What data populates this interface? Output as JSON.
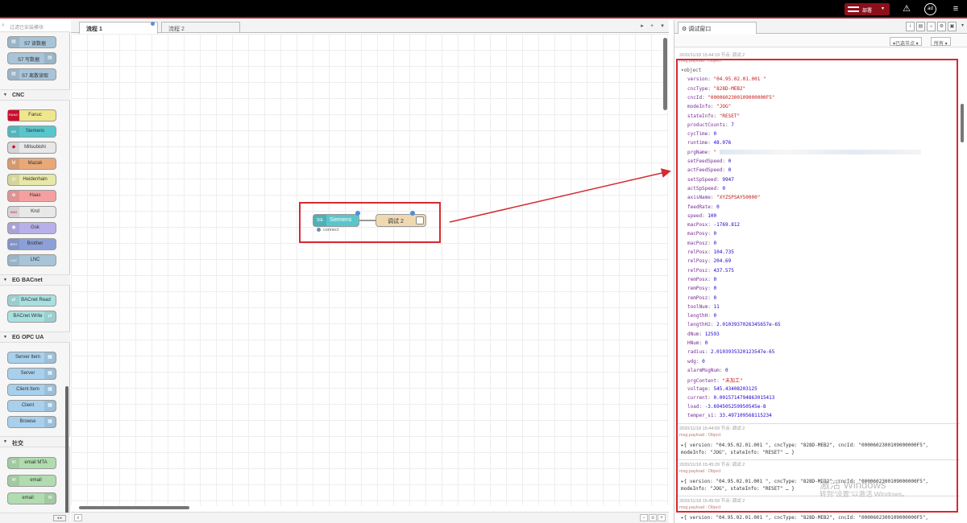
{
  "topbar": {
    "deploy_label": "部署",
    "deploy_caret": "▾",
    "alert_icon": "⚠",
    "user_label": "ad",
    "menu_icon": "≡"
  },
  "palette": {
    "search_placeholder": "过滤已安装模块",
    "top_nodes": [
      "S7 读数据",
      "S7 写数据",
      "S7 离散读取"
    ],
    "categories": {
      "cnc": "CNC",
      "bacnet": "EG BACnet",
      "opcua": "EG OPC UA",
      "social": "社交"
    },
    "cnc_nodes": [
      "Fanuc",
      "Siemens",
      "Mitsubishi",
      "Mazak",
      "Heidenhain",
      "Haas",
      "Knd",
      "Gsk",
      "Brother",
      "LNC"
    ],
    "cnc_icons": [
      "FANUC",
      "SIE",
      "◆",
      "M",
      "◎",
      "⊕",
      "KND",
      "◉",
      "BRO",
      "LNC"
    ],
    "bacnet_nodes": [
      "BACnet Read",
      "BACnet Write"
    ],
    "opcua_nodes": [
      "Server Item",
      "Server",
      "Client Item",
      "Client",
      "Browse"
    ],
    "social_nodes": [
      "email MTA",
      "email",
      "email"
    ]
  },
  "workspace": {
    "tabs": [
      "流程 1",
      "流程 2"
    ],
    "nodes": {
      "siemens_label": "Siemens",
      "siemens_icon": "SIE",
      "debug_label": "调试 2",
      "status_text": "connect"
    }
  },
  "sidebar": {
    "tab_label": "调试窗口",
    "filter_nodes": "▾已选节点 ▾",
    "filter_all": "所有 ▾",
    "first_msg": {
      "meta": "2020/11/18 15:44:19   节点: 调试 2",
      "topic": "msg.payload : Object",
      "object_label": "▾object",
      "props": [
        [
          "version",
          "\"04.95.02.01.001     \"",
          "s"
        ],
        [
          "cncType",
          "\"828D-MEB2\"",
          "s"
        ],
        [
          "cncId",
          "\"0000602300109000000F5\"",
          "s"
        ],
        [
          "modeInfo",
          "\"JOG\"",
          "s"
        ],
        [
          "stateInfo",
          "\"RESET\"",
          "s"
        ],
        [
          "productCounts",
          "7",
          "n"
        ],
        [
          "cycTime",
          "0",
          "n"
        ],
        [
          "runtime",
          "48.076",
          "n"
        ],
        [
          "prgName",
          "\"",
          "s"
        ],
        [
          "setFeedSpeed",
          "0",
          "n"
        ],
        [
          "actFeedSpeed",
          "0",
          "n"
        ],
        [
          "setSpSpeed",
          "9947",
          "n"
        ],
        [
          "actSpSpeed",
          "0",
          "n"
        ],
        [
          "axisName",
          "\"XYZSPSAY50000\"",
          "s"
        ],
        [
          "feedRate",
          "0",
          "n"
        ],
        [
          "speed",
          "100",
          "n"
        ],
        [
          "macPosx",
          "-1769.812",
          "n"
        ],
        [
          "macPosy",
          "0",
          "n"
        ],
        [
          "macPosz",
          "0",
          "n"
        ],
        [
          "relPosx",
          "104.735",
          "n"
        ],
        [
          "relPosy",
          "204.69",
          "n"
        ],
        [
          "relPosz",
          "437.575",
          "n"
        ],
        [
          "remPosx",
          "0",
          "n"
        ],
        [
          "remPosy",
          "0",
          "n"
        ],
        [
          "remPosz",
          "0",
          "n"
        ],
        [
          "toolNum",
          "11",
          "n"
        ],
        [
          "lengthH",
          "0",
          "n"
        ],
        [
          "lengthH2",
          "2.0103937026345657e-65",
          "n"
        ],
        [
          "dNum",
          "12593",
          "n"
        ],
        [
          "HNum",
          "0",
          "n"
        ],
        [
          "radius",
          "2.0103935320123547e-65",
          "n"
        ],
        [
          "wdg",
          "0",
          "n"
        ],
        [
          "alarmMsgNum",
          "0",
          "n"
        ],
        [
          "prgContent",
          "\"未加工\"",
          "s"
        ],
        [
          "voltage",
          "545.43408203125",
          "n"
        ],
        [
          "current",
          "0.0015714794863015413",
          "n"
        ],
        [
          "load",
          "-3.694505259950545e-8",
          "n"
        ],
        [
          "temper_s1",
          "33.497109568115234",
          "n"
        ]
      ]
    },
    "collapsed_msgs": [
      {
        "meta": "2020/11/18 15:44:59   节点: 调试 2",
        "topic": "msg.payload : Object",
        "line1": "▸{ version: \"04.95.02.01.001     \", cncType: \"828D-MEB2\", cncId: \"0000602300109000000F5\",",
        "line2": "modeInfo: \"JOG\", stateInfo: \"RESET\" … }"
      },
      {
        "meta": "2020/11/18 15:45:29   节点: 调试 2",
        "topic": "msg.payload : Object",
        "line1": "▸{ version: \"04.95.02.01.001     \", cncType: \"828D-MEB2\", cncId: \"0000602300109000000F5\",",
        "line2": "modeInfo: \"JOG\", stateInfo: \"RESET\" … }"
      },
      {
        "meta": "2020/11/18 15:45:59   节点: 调试 2",
        "topic": "msg.payload : Object",
        "line1": "▸{ version: \"04.95.02.01.001     \", cncType: \"828D-MEB2\", cncId: \"0000602300109000000F5\",",
        "line2": ""
      }
    ]
  },
  "watermark": {
    "line1": "激活 Windows",
    "line2": "转到\"设置\"以激活 Windows。"
  },
  "colors": {
    "topbar": "#000000",
    "deploy": "#8c101c",
    "highlight": "#d42a30",
    "siemens_node": "#59c6cc",
    "debug_node": "#f0d9b0"
  }
}
